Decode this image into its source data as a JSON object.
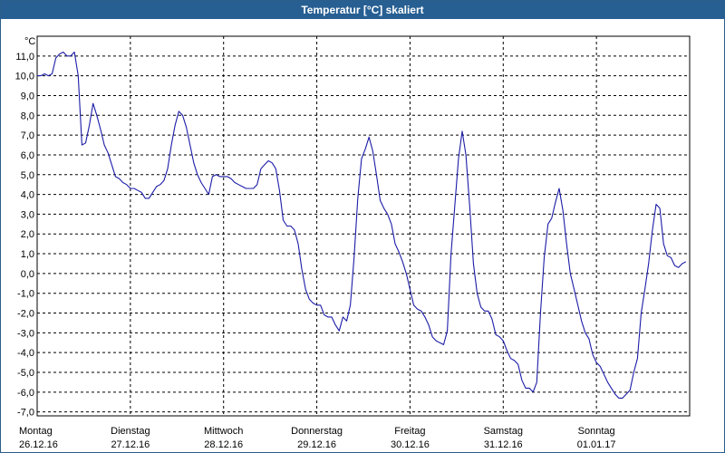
{
  "window": {
    "title": "Temperatur [°C] skaliert"
  },
  "chart_data": {
    "type": "line",
    "title": "Temperatur [°C] skaliert",
    "ylabel": "°C",
    "xlabel": "",
    "ylim": [
      -7.2,
      12.0
    ],
    "xlim": [
      0,
      7
    ],
    "grid": true,
    "yticks": [
      -7,
      -6,
      -5,
      -4,
      -3,
      -2,
      -1,
      0,
      1,
      2,
      3,
      4,
      5,
      6,
      7,
      8,
      9,
      10,
      11
    ],
    "ytick_labels": [
      "-7,0",
      "-6,0",
      "-5,0",
      "-4,0",
      "-3,0",
      "-2,0",
      "-1,0",
      "0,0",
      "1,0",
      "2,0",
      "3,0",
      "4,0",
      "5,0",
      "6,0",
      "7,0",
      "8,0",
      "9,0",
      "10,0",
      "11,0"
    ],
    "x_tick_labels": [
      {
        "day": "Montag",
        "date": "26.12.16"
      },
      {
        "day": "Dienstag",
        "date": "27.12.16"
      },
      {
        "day": "Mittwoch",
        "date": "28.12.16"
      },
      {
        "day": "Donnerstag",
        "date": "29.12.16"
      },
      {
        "day": "Freitag",
        "date": "30.12.16"
      },
      {
        "day": "Samstag",
        "date": "31.12.16"
      },
      {
        "day": "Sonntag",
        "date": "01.01.17"
      }
    ],
    "series": [
      {
        "color": "#1c1ca8",
        "points": [
          [
            0.0,
            10.0
          ],
          [
            0.04,
            10.0
          ],
          [
            0.08,
            10.1
          ],
          [
            0.12,
            10.0
          ],
          [
            0.16,
            10.1
          ],
          [
            0.2,
            10.9
          ],
          [
            0.24,
            11.1
          ],
          [
            0.28,
            11.2
          ],
          [
            0.32,
            11.0
          ],
          [
            0.36,
            11.0
          ],
          [
            0.4,
            11.2
          ],
          [
            0.44,
            10.0
          ],
          [
            0.48,
            6.5
          ],
          [
            0.52,
            6.6
          ],
          [
            0.56,
            7.5
          ],
          [
            0.6,
            8.6
          ],
          [
            0.64,
            8.0
          ],
          [
            0.68,
            7.3
          ],
          [
            0.72,
            6.5
          ],
          [
            0.76,
            6.1
          ],
          [
            0.8,
            5.5
          ],
          [
            0.84,
            4.9
          ],
          [
            0.88,
            4.8
          ],
          [
            0.92,
            4.6
          ],
          [
            0.96,
            4.5
          ],
          [
            1.0,
            4.3
          ],
          [
            1.04,
            4.3
          ],
          [
            1.08,
            4.2
          ],
          [
            1.12,
            4.1
          ],
          [
            1.16,
            3.8
          ],
          [
            1.2,
            3.8
          ],
          [
            1.24,
            4.1
          ],
          [
            1.28,
            4.4
          ],
          [
            1.32,
            4.5
          ],
          [
            1.36,
            4.7
          ],
          [
            1.4,
            5.3
          ],
          [
            1.44,
            6.5
          ],
          [
            1.48,
            7.5
          ],
          [
            1.52,
            8.2
          ],
          [
            1.56,
            8.0
          ],
          [
            1.6,
            7.4
          ],
          [
            1.64,
            6.5
          ],
          [
            1.68,
            5.6
          ],
          [
            1.72,
            5.0
          ],
          [
            1.76,
            4.6
          ],
          [
            1.8,
            4.3
          ],
          [
            1.84,
            4.0
          ],
          [
            1.88,
            4.9
          ],
          [
            1.92,
            5.0
          ],
          [
            1.96,
            4.9
          ],
          [
            2.0,
            4.9
          ],
          [
            2.04,
            4.9
          ],
          [
            2.08,
            4.8
          ],
          [
            2.12,
            4.6
          ],
          [
            2.16,
            4.5
          ],
          [
            2.2,
            4.4
          ],
          [
            2.24,
            4.3
          ],
          [
            2.28,
            4.3
          ],
          [
            2.32,
            4.3
          ],
          [
            2.36,
            4.5
          ],
          [
            2.4,
            5.3
          ],
          [
            2.44,
            5.5
          ],
          [
            2.48,
            5.7
          ],
          [
            2.52,
            5.6
          ],
          [
            2.56,
            5.3
          ],
          [
            2.6,
            4.2
          ],
          [
            2.64,
            2.7
          ],
          [
            2.68,
            2.4
          ],
          [
            2.72,
            2.4
          ],
          [
            2.76,
            2.2
          ],
          [
            2.8,
            1.5
          ],
          [
            2.84,
            0.2
          ],
          [
            2.88,
            -0.8
          ],
          [
            2.92,
            -1.3
          ],
          [
            2.96,
            -1.5
          ],
          [
            3.0,
            -1.6
          ],
          [
            3.04,
            -1.6
          ],
          [
            3.08,
            -2.1
          ],
          [
            3.12,
            -2.2
          ],
          [
            3.16,
            -2.2
          ],
          [
            3.2,
            -2.6
          ],
          [
            3.24,
            -2.9
          ],
          [
            3.28,
            -2.2
          ],
          [
            3.32,
            -2.4
          ],
          [
            3.36,
            -1.6
          ],
          [
            3.4,
            0.8
          ],
          [
            3.44,
            3.8
          ],
          [
            3.48,
            5.8
          ],
          [
            3.52,
            6.3
          ],
          [
            3.56,
            6.9
          ],
          [
            3.6,
            6.2
          ],
          [
            3.64,
            5.0
          ],
          [
            3.68,
            3.7
          ],
          [
            3.72,
            3.3
          ],
          [
            3.76,
            3.0
          ],
          [
            3.8,
            2.5
          ],
          [
            3.84,
            1.5
          ],
          [
            3.88,
            1.1
          ],
          [
            3.92,
            0.6
          ],
          [
            3.96,
            0.0
          ],
          [
            4.0,
            -0.8
          ],
          [
            4.04,
            -1.6
          ],
          [
            4.08,
            -1.8
          ],
          [
            4.12,
            -1.9
          ],
          [
            4.16,
            -2.2
          ],
          [
            4.2,
            -2.6
          ],
          [
            4.24,
            -3.2
          ],
          [
            4.28,
            -3.4
          ],
          [
            4.32,
            -3.5
          ],
          [
            4.36,
            -3.6
          ],
          [
            4.4,
            -2.9
          ],
          [
            4.44,
            1.0
          ],
          [
            4.48,
            3.4
          ],
          [
            4.52,
            5.8
          ],
          [
            4.56,
            7.2
          ],
          [
            4.6,
            6.0
          ],
          [
            4.64,
            3.4
          ],
          [
            4.68,
            0.5
          ],
          [
            4.72,
            -1.0
          ],
          [
            4.76,
            -1.7
          ],
          [
            4.8,
            -1.9
          ],
          [
            4.84,
            -1.9
          ],
          [
            4.88,
            -2.3
          ],
          [
            4.92,
            -3.1
          ],
          [
            4.96,
            -3.2
          ],
          [
            5.0,
            -3.4
          ],
          [
            5.04,
            -3.9
          ],
          [
            5.08,
            -4.3
          ],
          [
            5.12,
            -4.4
          ],
          [
            5.16,
            -4.6
          ],
          [
            5.2,
            -5.4
          ],
          [
            5.24,
            -5.8
          ],
          [
            5.28,
            -5.8
          ],
          [
            5.32,
            -6.0
          ],
          [
            5.36,
            -5.5
          ],
          [
            5.4,
            -2.0
          ],
          [
            5.44,
            0.8
          ],
          [
            5.48,
            2.5
          ],
          [
            5.52,
            2.8
          ],
          [
            5.56,
            3.6
          ],
          [
            5.6,
            4.3
          ],
          [
            5.64,
            3.2
          ],
          [
            5.68,
            1.5
          ],
          [
            5.72,
            0.0
          ],
          [
            5.76,
            -0.8
          ],
          [
            5.8,
            -1.6
          ],
          [
            5.84,
            -2.4
          ],
          [
            5.88,
            -3.0
          ],
          [
            5.92,
            -3.3
          ],
          [
            5.96,
            -4.1
          ],
          [
            6.0,
            -4.5
          ],
          [
            6.04,
            -4.7
          ],
          [
            6.08,
            -5.1
          ],
          [
            6.12,
            -5.5
          ],
          [
            6.16,
            -5.8
          ],
          [
            6.2,
            -6.1
          ],
          [
            6.24,
            -6.3
          ],
          [
            6.28,
            -6.3
          ],
          [
            6.32,
            -6.1
          ],
          [
            6.36,
            -5.9
          ],
          [
            6.4,
            -5.0
          ],
          [
            6.44,
            -4.3
          ],
          [
            6.48,
            -2.0
          ],
          [
            6.52,
            -0.8
          ],
          [
            6.56,
            0.5
          ],
          [
            6.6,
            2.2
          ],
          [
            6.64,
            3.5
          ],
          [
            6.68,
            3.3
          ],
          [
            6.72,
            1.5
          ],
          [
            6.76,
            0.9
          ],
          [
            6.8,
            0.8
          ],
          [
            6.84,
            0.4
          ],
          [
            6.88,
            0.3
          ],
          [
            6.92,
            0.5
          ],
          [
            6.96,
            0.6
          ]
        ]
      }
    ]
  }
}
